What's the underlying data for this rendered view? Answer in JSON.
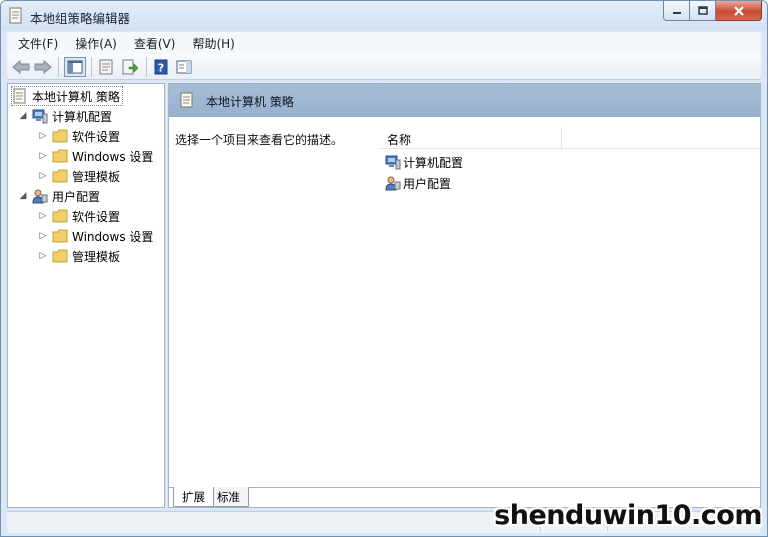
{
  "window": {
    "title": "本地组策略编辑器",
    "controls": {
      "minimize": "–",
      "maximize": "□",
      "close": "✕"
    }
  },
  "menu": [
    {
      "label": "文件(F)"
    },
    {
      "label": "操作(A)"
    },
    {
      "label": "查看(V)"
    },
    {
      "label": "帮助(H)"
    }
  ],
  "toolbar": {
    "icons": [
      "back-arrow-icon",
      "forward-arrow-icon",
      "show-hide-tree-icon",
      "properties-icon",
      "export-list-icon",
      "help-icon",
      "show-action-pane-icon"
    ]
  },
  "tree": {
    "root": "本地计算机 策略",
    "computer_config": {
      "label": "计算机配置",
      "children": [
        "软件设置",
        "Windows 设置",
        "管理模板"
      ]
    },
    "user_config": {
      "label": "用户配置",
      "children": [
        "软件设置",
        "Windows 设置",
        "管理模板"
      ]
    }
  },
  "main": {
    "header": "本地计算机 策略",
    "description": "选择一个项目来查看它的描述。",
    "column_header": "名称",
    "items": [
      "计算机配置",
      "用户配置"
    ]
  },
  "tabs": [
    {
      "label": "扩展",
      "active": true
    },
    {
      "label": "标准",
      "active": false
    }
  ],
  "watermark": "shenduwin10.com",
  "colors": {
    "header_bar": "#9fb7d2",
    "window_frame": "#dbe7f4",
    "folder": "#f2cf6b"
  }
}
